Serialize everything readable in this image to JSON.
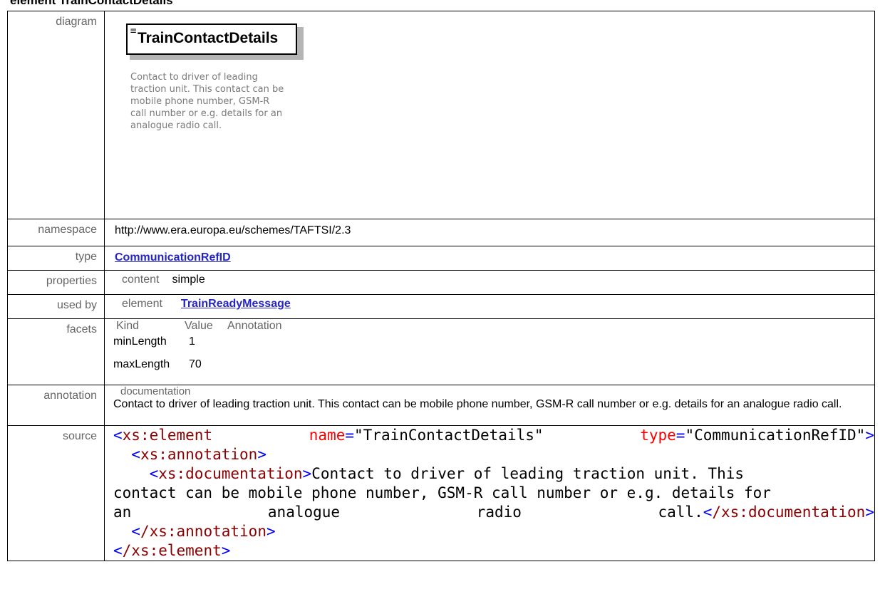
{
  "heading": "element TrainContactDetails",
  "labels": {
    "diagram": "diagram",
    "namespace": "namespace",
    "type": "type",
    "properties": "properties",
    "used_by": "used by",
    "facets": "facets",
    "annotation": "annotation",
    "source": "source"
  },
  "diagram": {
    "title": "TrainContactDetails",
    "description": "Contact to driver of leading traction unit. This contact can be mobile phone number, GSM-R call number or e.g. details for an analogue radio call.",
    "icon": "element-lines-icon"
  },
  "namespace": "http://www.era.europa.eu/schemes/TAFTSI/2.3",
  "type": "CommunicationRefID",
  "properties": {
    "label": "content",
    "value": "simple"
  },
  "used_by": {
    "kind": "element",
    "name": "TrainReadyMessage"
  },
  "facets": {
    "headers": [
      "Kind",
      "Value",
      "Annotation"
    ],
    "rows": [
      {
        "kind": "minLength",
        "value": "1"
      },
      {
        "kind": "maxLength",
        "value": "70"
      }
    ]
  },
  "annotation": {
    "header": "documentation",
    "text": "Contact to driver of leading traction unit. This contact can be mobile phone number, GSM-R call number or e.g. details for an analogue radio call."
  },
  "source": {
    "open_tag": "xs:element",
    "attr1_name": "name",
    "attr1_value": "\"TrainContactDetails\"",
    "attr2_name": "type",
    "attr2_value": "\"CommunicationRefID\"",
    "annotation_tag": "xs:annotation",
    "documentation_tag": "xs:documentation",
    "doc_line1": "Contact to driver of leading traction unit. This",
    "doc_line2": "contact can be mobile phone number, GSM-R call number or e.g. details for",
    "doc_line3_words": [
      "an",
      "analogue",
      "radio",
      "call."
    ],
    "close_documentation": "/xs:documentation",
    "close_annotation": "/xs:annotation",
    "close_element": "/xs:element"
  },
  "colors": {
    "tag": "#8b0000",
    "bracket": "#0000ff",
    "attribute": "#ff0000",
    "link": "#2525c7",
    "label": "#666666"
  }
}
